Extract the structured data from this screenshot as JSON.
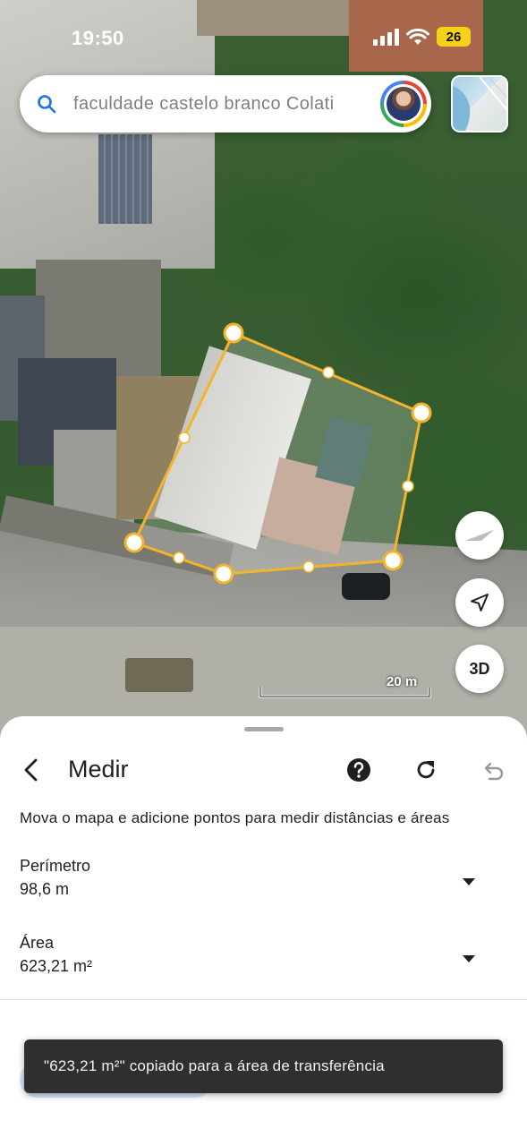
{
  "status_bar": {
    "time": "19:50",
    "battery": "26"
  },
  "search": {
    "query": "faculdade castelo branco Colati"
  },
  "map": {
    "scale_label": "20 m",
    "button_3d": "3D"
  },
  "measure_panel": {
    "title": "Medir",
    "instruction": "Mova o mapa e adicione pontos para medir distâncias e áreas",
    "perimeter": {
      "label": "Perímetro",
      "value": "98,6 m"
    },
    "area": {
      "label": "Área",
      "value": "623,21 m²"
    }
  },
  "toast": {
    "message": "\"623,21 m²\" copiado para a área de transferência"
  },
  "colors": {
    "accent_polygon": "#f4b32a",
    "polygon_fill": "rgba(255,255,255,0.2)",
    "toast_bg": "#2f2f2f",
    "search_icon": "#1a73e8"
  },
  "icons": [
    "search-icon",
    "signal-icon",
    "wifi-icon",
    "battery-icon",
    "layers-icon",
    "compass-icon",
    "navigation-icon",
    "back-arrow-icon",
    "help-icon",
    "refresh-icon",
    "undo-icon",
    "dropdown-caret-icon"
  ]
}
